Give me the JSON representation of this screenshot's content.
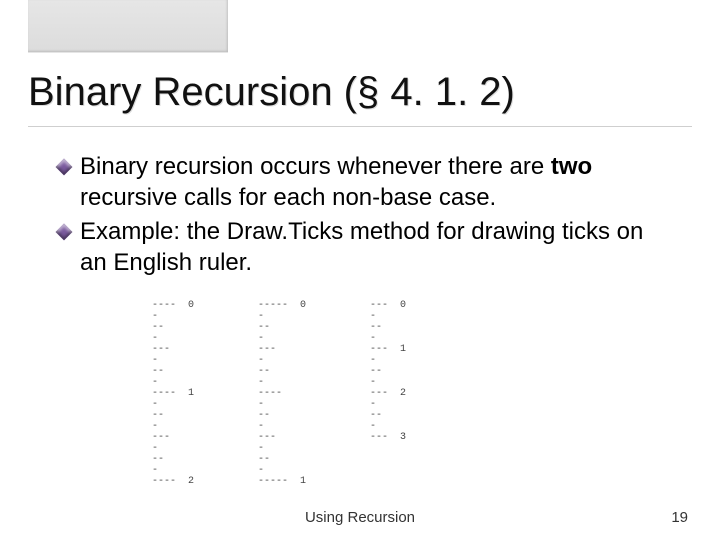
{
  "title": "Binary Recursion (§ 4. 1. 2)",
  "bullets": {
    "b1_pre": "Binary recursion occurs whenever there are ",
    "b1_bold": "two",
    "b1_post": " recursive calls for each non-base case.",
    "b2": "Example: the Draw.Ticks method for drawing ticks on an English ruler."
  },
  "ruler_columns": {
    "col0": "----  0\n-\n--\n-\n---\n-\n--\n-\n----  1\n-\n--\n-\n---\n-\n--\n-\n----  2",
    "col1": "-----  0\n-\n--\n-\n---\n-\n--\n-\n----\n-\n--\n-\n---\n-\n--\n-\n-----  1",
    "col2": "---  0\n-\n--\n-\n---  1\n-\n--\n-\n---  2\n-\n--\n-\n---  3"
  },
  "footer": {
    "center": "Using Recursion",
    "page": "19"
  }
}
